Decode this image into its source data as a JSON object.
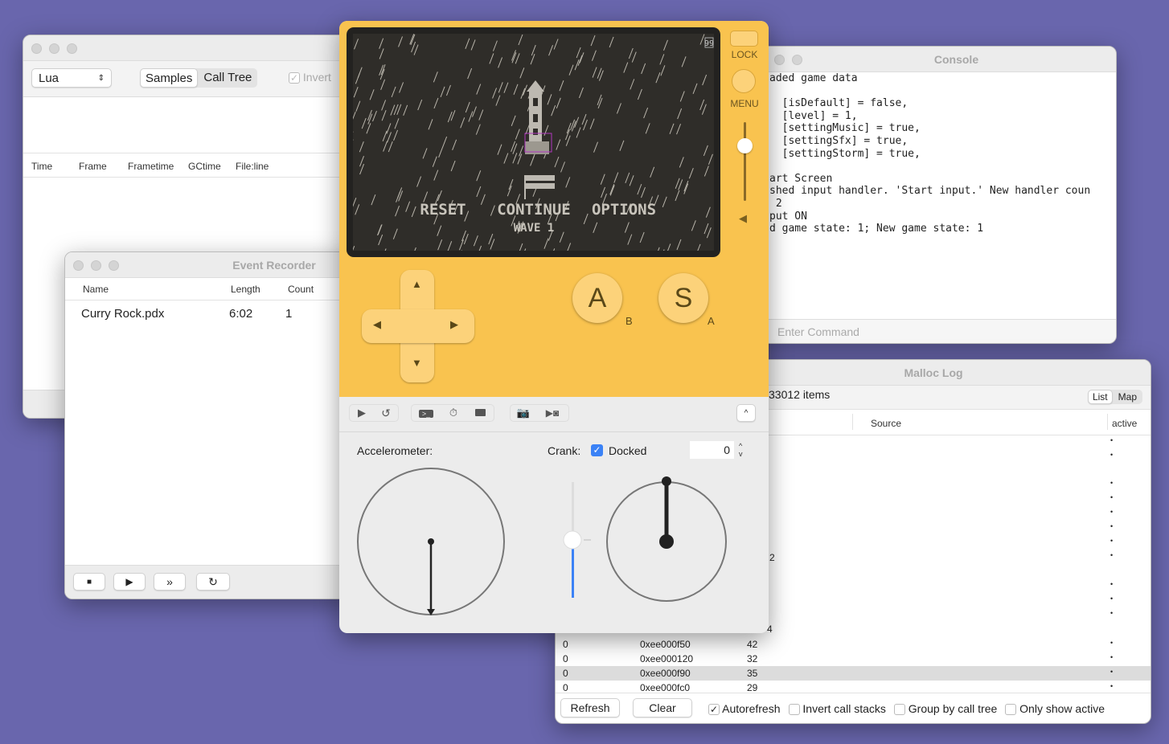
{
  "profiler": {
    "language": "Lua",
    "tabs": [
      "Samples",
      "Call Tree"
    ],
    "invert_label": "Invert",
    "invert_checked": true,
    "columns": [
      "Time",
      "Frame",
      "Frametime",
      "GCtime",
      "File:line"
    ]
  },
  "event_recorder": {
    "title": "Event Recorder",
    "columns": [
      "Name",
      "Length",
      "Count"
    ],
    "rows": [
      {
        "name": "Curry Rock.pdx",
        "length": "6:02",
        "count": "1"
      }
    ],
    "controls": [
      "stop-icon",
      "play-icon",
      "fast-forward-icon",
      "loop-icon"
    ]
  },
  "console": {
    "title": "Console",
    "lines": [
      "aded game data",
      "",
      "  [isDefault] = false,",
      "  [level] = 1,",
      "  [settingMusic] = true,",
      "  [settingSfx] = true,",
      "  [settingStorm] = true,",
      "",
      "art Screen",
      "shed input handler. 'Start input.' New handler coun",
      " 2",
      "put ON",
      "d game state: 1; New game state: 1"
    ],
    "input_placeholder": "Enter Command"
  },
  "malloc": {
    "title": "Malloc Log",
    "items": "33012 items",
    "view_tabs": [
      "List",
      "Map"
    ],
    "columns": [
      "Source",
      "active"
    ],
    "partial_values": [
      "2",
      "4"
    ],
    "rows": [
      {
        "c1": "0",
        "addr": "0xee000f50",
        "size": "42",
        "active": "•"
      },
      {
        "c1": "0",
        "addr": "0xee000120",
        "size": "32",
        "active": "•"
      },
      {
        "c1": "0",
        "addr": "0xee000f90",
        "size": "35",
        "active": "•",
        "selected": true
      },
      {
        "c1": "0",
        "addr": "0xee000fc0",
        "size": "29",
        "active": "•"
      }
    ],
    "buttons": {
      "refresh": "Refresh",
      "clear": "Clear"
    },
    "options": [
      {
        "label": "Autorefresh",
        "checked": true
      },
      {
        "label": "Invert call stacks",
        "checked": false
      },
      {
        "label": "Group by call tree",
        "checked": false
      },
      {
        "label": "Only show active",
        "checked": false
      }
    ]
  },
  "simulator": {
    "body_color": "#f9c34f",
    "screen": {
      "menu": [
        "RESET",
        "CONTINUE",
        "OPTIONS"
      ],
      "subtitle": "WAVE 1",
      "fps": "99"
    },
    "lock_label": "LOCK",
    "menu_label": "MENU",
    "volume": 0.7,
    "buttons": {
      "a": "A",
      "a_sub": "B",
      "s": "S",
      "s_sub": "A"
    },
    "toolbar": [
      "play-icon",
      "restart-icon",
      "console-icon",
      "stopwatch-icon",
      "memory-chip-icon",
      "screenshot-icon",
      "record-icon"
    ],
    "accelerometer_label": "Accelerometer:",
    "crank_label": "Crank:",
    "docked_label": "Docked",
    "docked": true,
    "crank_value": "0",
    "crank_angle": 0,
    "crank_speed": 0.5
  }
}
